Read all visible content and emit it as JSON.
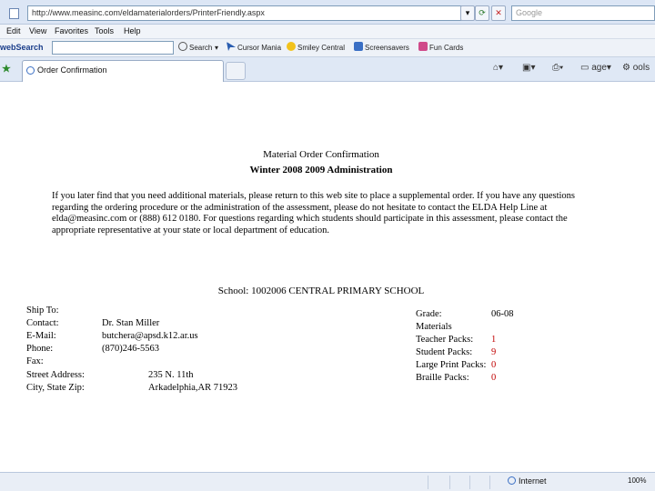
{
  "browser": {
    "address": "http://www.measinc.com/eldamaterialorders/PrinterFriendly.aspx",
    "search_placeholder": "Google",
    "menu": [
      "Edit",
      "View",
      "Favorites",
      "Tools",
      "Help"
    ],
    "toolbar": {
      "brand": "webSearch",
      "search_label": "Search",
      "buttons": [
        "Cursor Mania",
        "Smiley Central",
        "Screensavers",
        "Fun Cards"
      ]
    },
    "tab_title": "Order Confirmation",
    "commands": [
      "age",
      "ools"
    ],
    "status": {
      "zone": "Internet",
      "zoom": "100%"
    }
  },
  "document": {
    "title": "Material Order Confirmation",
    "subtitle": "Winter 2008 2009 Administration",
    "paragraph": "If you later find that you need additional materials, please return to this web site to place a supplemental order. If you have any questions regarding the ordering procedure or the administration of the assessment, please do not hesitate to contact the ELDA Help Line at elda@measinc.com or (888) 612 0180. For questions regarding which students should participate in this assessment, please contact the appropriate representative at your state or local department of education.",
    "school": "School: 1002006 CENTRAL PRIMARY SCHOOL",
    "ship_to_label": "Ship To:",
    "contact_label": "Contact:",
    "contact_value": "Dr. Stan Miller",
    "email_label": "E-Mail:",
    "email_value": "butchera@apsd.k12.ar.us",
    "phone_label": "Phone:",
    "phone_value": "(870)246-5563",
    "fax_label": "Fax:",
    "street_label": "Street Address:",
    "street_value": "235 N. 11th",
    "city_label": "City, State Zip:",
    "city_value": "Arkadelphia,AR 71923",
    "grade_label": "Grade:",
    "grade_value": "06-08",
    "materials_label": "Materials",
    "teacher_label": "Teacher Packs:",
    "teacher_value": "1",
    "student_label": "Student Packs:",
    "student_value": "9",
    "large_label": "Large Print Packs:",
    "large_value": "0",
    "braille_label": "Braille Packs:",
    "braille_value": "0"
  },
  "colors": {
    "chrome": "#dce6f5",
    "count_red": "#c00000"
  }
}
